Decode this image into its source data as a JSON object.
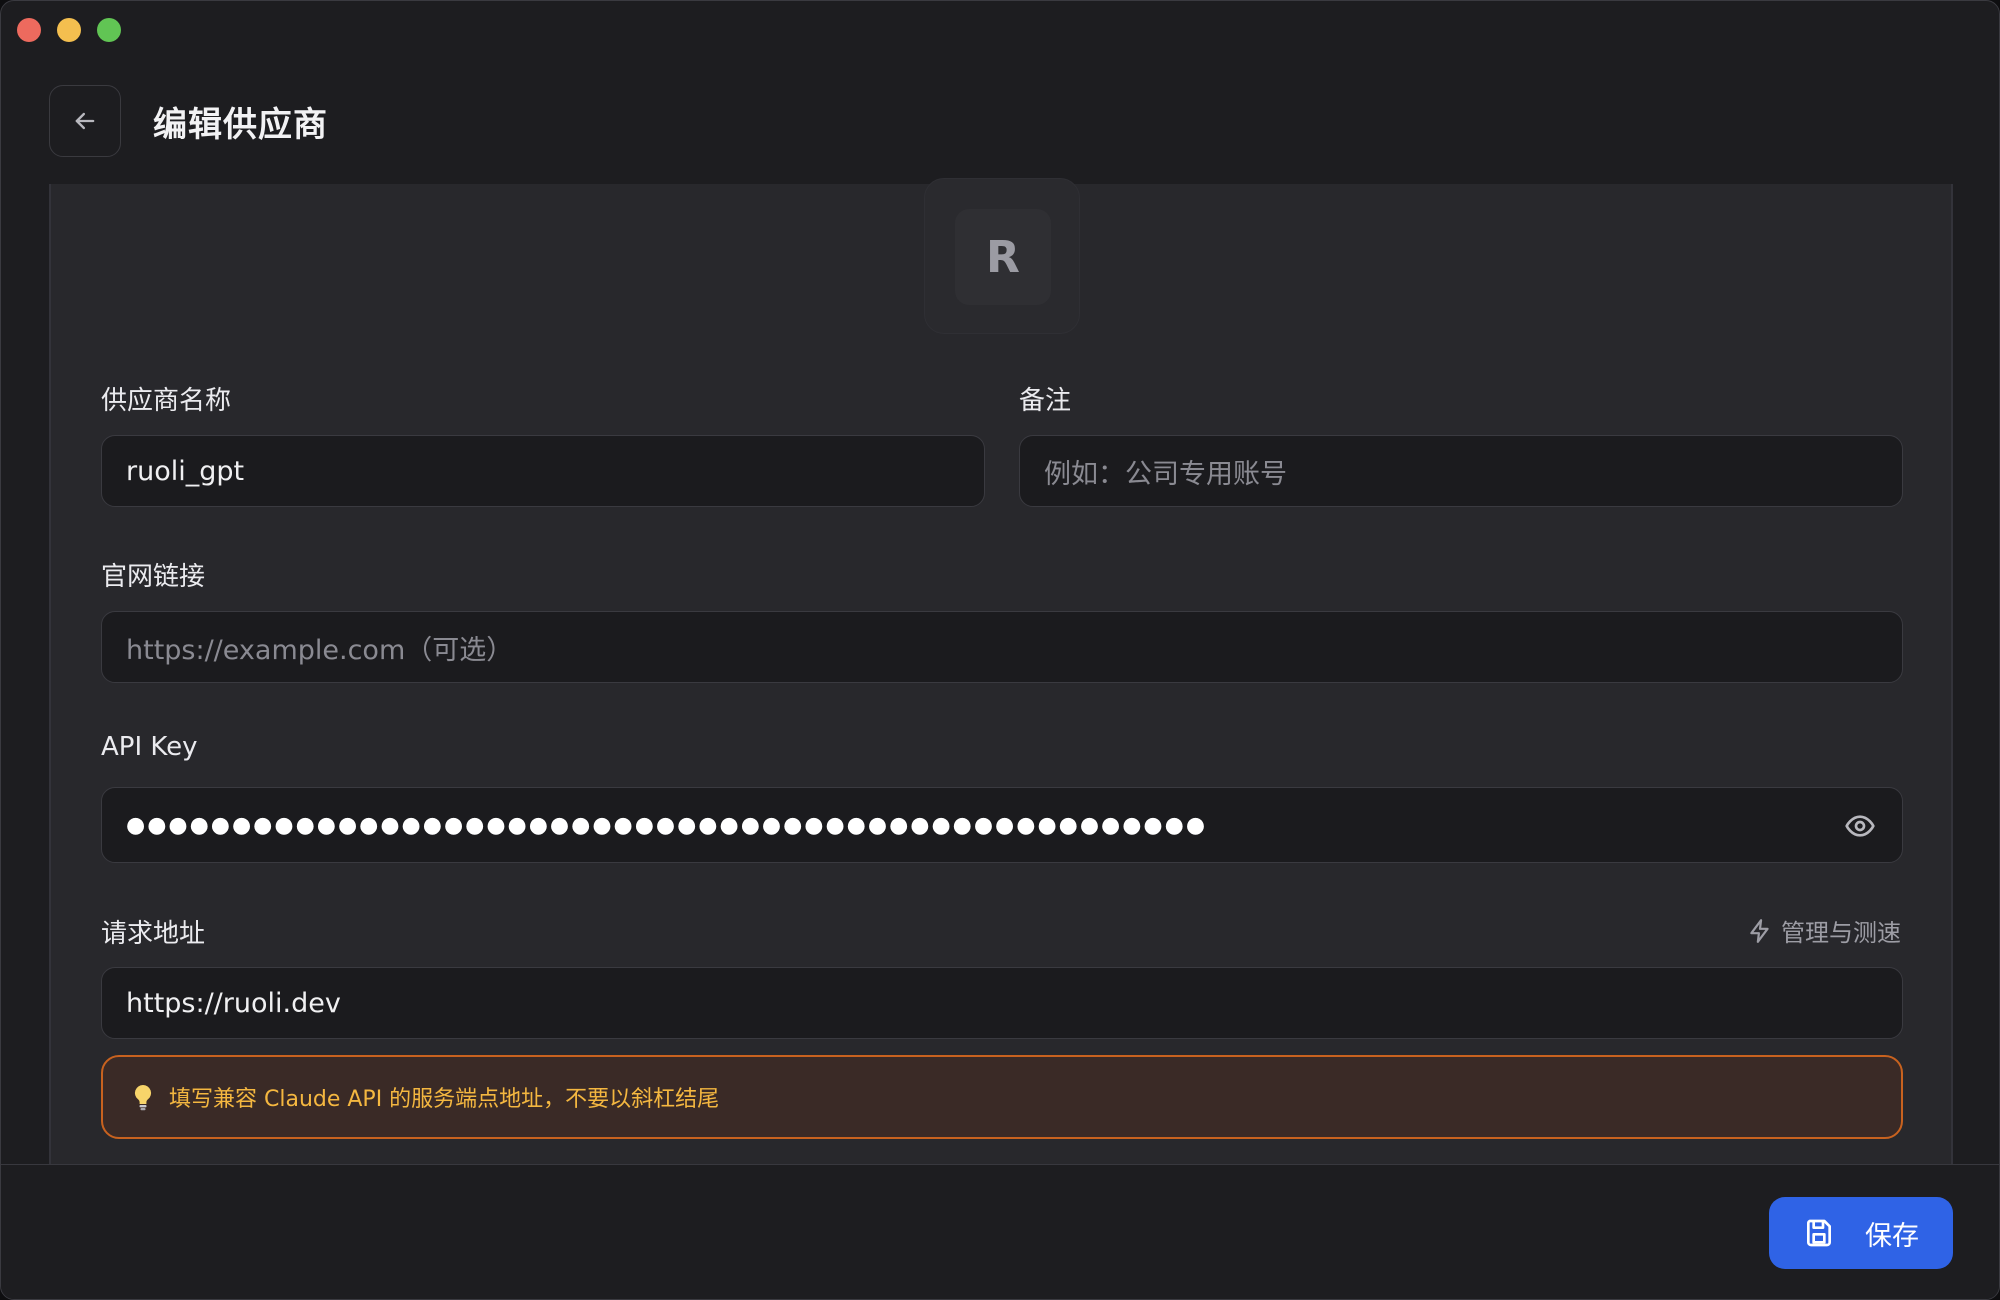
{
  "header": {
    "title": "编辑供应商"
  },
  "avatar": {
    "letter": "R"
  },
  "form": {
    "name_label": "供应商名称",
    "name_value": "ruoli_gpt",
    "note_label": "备注",
    "note_placeholder": "例如：公司专用账号",
    "website_label": "官网链接",
    "website_placeholder": "https://example.com（可选）",
    "apikey_label": "API Key",
    "apikey_masked": "●●●●●●●●●●●●●●●●●●●●●●●●●●●●●●●●●●●●●●●●●●●●●●●●●●●",
    "endpoint_label": "请求地址",
    "endpoint_value": "https://ruoli.dev",
    "manage_label": "管理与测速",
    "hint_text": "填写兼容 Claude API 的服务端点地址，不要以斜杠结尾"
  },
  "footer": {
    "save_label": "保存"
  },
  "colors": {
    "accent": "#2f63e6",
    "hint_border": "#c8621f",
    "hint_text": "#f4b740"
  },
  "icons": [
    "back-arrow-icon",
    "eye-icon",
    "lightning-icon",
    "lightbulb-icon",
    "floppy-disk-icon"
  ]
}
